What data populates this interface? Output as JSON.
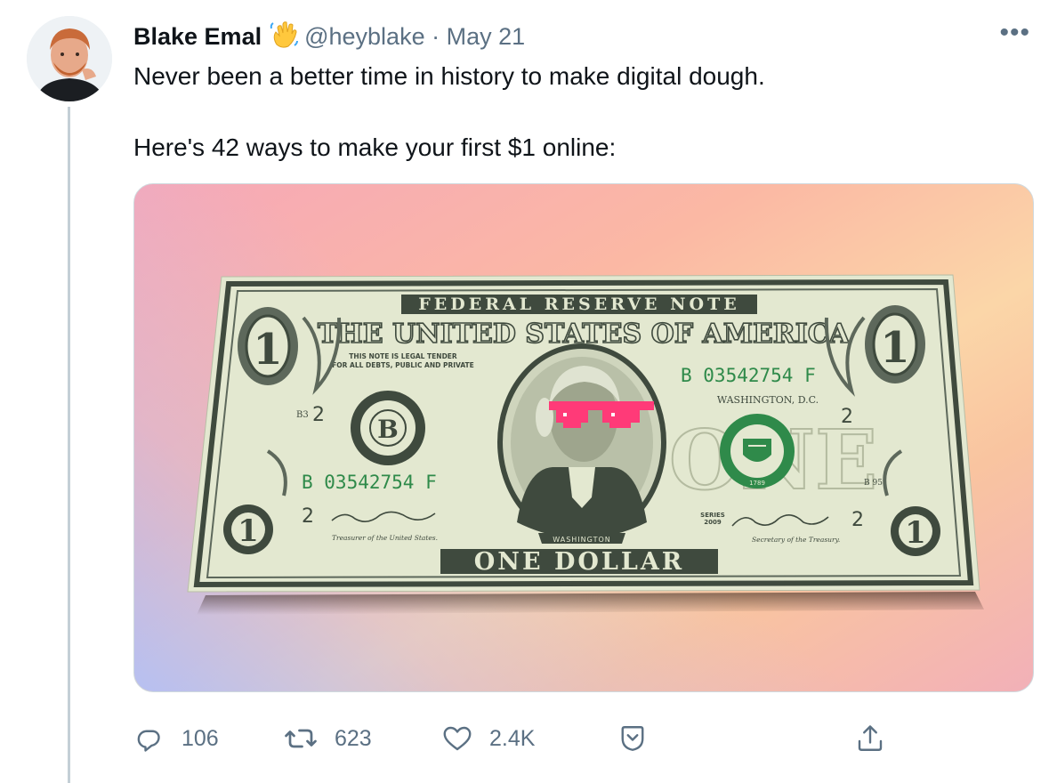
{
  "tweet": {
    "author_name": "Blake Emal",
    "author_handle": "@heyblake",
    "separator": "·",
    "date": "May 21",
    "more_label": "•••",
    "text_line1": "Never been a better time in history to make digital dough.",
    "text_line2": "Here's 42 ways to make your first $1 online:"
  },
  "media": {
    "bill": {
      "top_banner": "FEDERAL RESERVE NOTE",
      "title": "THE UNITED STATES OF AMERICA",
      "legal_tender_line1": "THIS NOTE IS LEGAL TENDER",
      "legal_tender_line2": "FOR ALL DEBTS, PUBLIC AND PRIVATE",
      "serial_number": "B 03542754 F",
      "city": "WASHINGTON, D.C.",
      "district_letter": "B",
      "district_code": "B3",
      "district_code_right": "B 95",
      "corner_number": "2",
      "denomination": "1",
      "series_label": "SERIES",
      "series_year": "2009",
      "treasurer_label": "Treasurer of the United States.",
      "secretary_label": "Secretary of the Treasury.",
      "portrait_label": "WASHINGTON",
      "seal_year": "1789",
      "bottom_text": "ONE DOLLAR",
      "background_word": "ONE"
    }
  },
  "actions": {
    "reply_count": "106",
    "retweet_count": "623",
    "like_count": "2.4K"
  },
  "colors": {
    "muted_text": "#5b7083",
    "thread_line": "#c4cfd6",
    "bill_paper": "#e3e8d0",
    "bill_ink": "#3f4a3e",
    "serial_green": "#2f8a4a",
    "sunglasses": "#ff3a78"
  },
  "icons": [
    "waving-hand-icon",
    "more-icon",
    "reply-icon",
    "retweet-icon",
    "like-icon",
    "bookmark-icon",
    "share-icon"
  ]
}
